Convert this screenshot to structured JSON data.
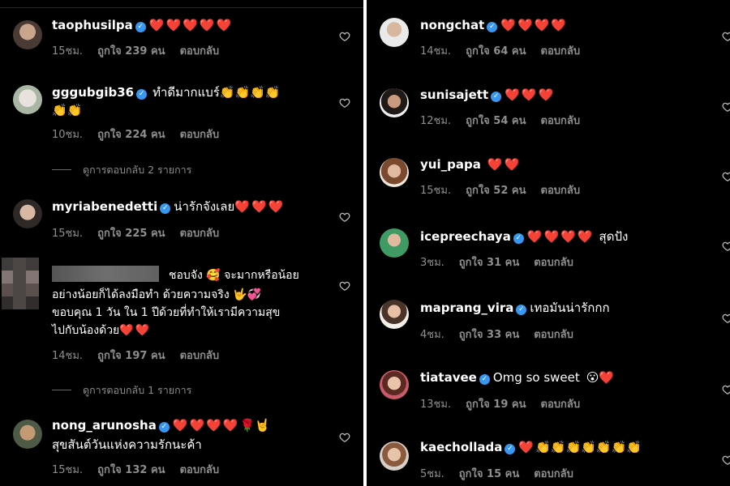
{
  "left": {
    "comments": [
      {
        "username": "taophusilpa",
        "body": "",
        "hearts": "❤️❤️❤️❤️❤️",
        "time": "15ชม.",
        "likes": "ถูกใจ 239 คน",
        "reply": "ตอบกลับ"
      },
      {
        "username": "gggubgib36",
        "body": "ทำดีมากแบร์",
        "body_after": "👏👏👏👏",
        "line2": "👏👏",
        "time": "10ชม.",
        "likes": "ถูกใจ 224 คน",
        "reply": "ตอบกลับ",
        "view_replies": "ดูการตอบกลับ 2 รายการ"
      },
      {
        "username": "myriabenedetti",
        "body": "น่ารักจังเลย",
        "hearts": "❤️❤️❤️",
        "time": "15ชม.",
        "likes": "ถูกใจ 225 คน",
        "reply": "ตอบกลับ"
      },
      {
        "username": "",
        "line1": "ชอบจัง 🥰 จะมากหรือน้อย",
        "line2": "อย่างน้อยก็ได้ลงมือทำ ด้วยความจริง 🤟💞",
        "line3": "ขอบคุณ 1 วัน ใน 1 ปีด้วยที่ทำให้เรามีความสุข",
        "line4": "ไปกับน้องด้วย",
        "hearts": "❤️❤️",
        "time": "14ชม.",
        "likes": "ถูกใจ 197 คน",
        "reply": "ตอบกลับ",
        "view_replies": "ดูการตอบกลับ 1 รายการ"
      },
      {
        "username": "nong_arunosha",
        "hearts": "❤️❤️❤️❤️",
        "extra": "🌹🤘",
        "line2": "สุขสันต์วันแห่งความรักนะค้า",
        "time": "15ชม.",
        "likes": "ถูกใจ 132 คน",
        "reply": "ตอบกลับ"
      }
    ]
  },
  "right": {
    "comments": [
      {
        "username": "nongchat",
        "hearts": "❤️❤️❤️❤️",
        "time": "14ชม.",
        "likes": "ถูกใจ 64 คน",
        "reply": "ตอบกลับ"
      },
      {
        "username": "sunisajett",
        "hearts": "❤️❤️❤️",
        "time": "12ชม.",
        "likes": "ถูกใจ 54 คน",
        "reply": "ตอบกลับ"
      },
      {
        "username": "yui_papa",
        "hearts": "❤️❤️",
        "time": "15ชม.",
        "likes": "ถูกใจ 52 คน",
        "reply": "ตอบกลับ"
      },
      {
        "username": "icepreechaya",
        "hearts": "❤️❤️❤️❤️",
        "after": "สุดปัง",
        "time": "3ชม.",
        "likes": "ถูกใจ 31 คน",
        "reply": "ตอบกลับ"
      },
      {
        "username": "maprang_vira",
        "body": "เทอมันน่ารักกก",
        "time": "4ชม.",
        "likes": "ถูกใจ 33 คน",
        "reply": "ตอบกลับ"
      },
      {
        "username": "tiatavee",
        "body": "Omg so sweet",
        "emoji": "😮",
        "hearts": "❤️",
        "time": "13ชม.",
        "likes": "ถูกใจ 19 คน",
        "reply": "ตอบกลับ"
      },
      {
        "username": "kaechollada",
        "hearts": "❤️",
        "claps": "👏👏👏👏👏👏👏",
        "time": "5ชม.",
        "likes": "ถูกใจ 15 คน",
        "reply": "ตอบกลับ"
      }
    ]
  },
  "icons": {
    "verified": "verified-badge-icon",
    "like": "heart-outline-icon"
  },
  "colors": {
    "background": "#000000",
    "verified": "#3897f0",
    "heart": "#ed4956",
    "meta": "#8e8e8e"
  }
}
